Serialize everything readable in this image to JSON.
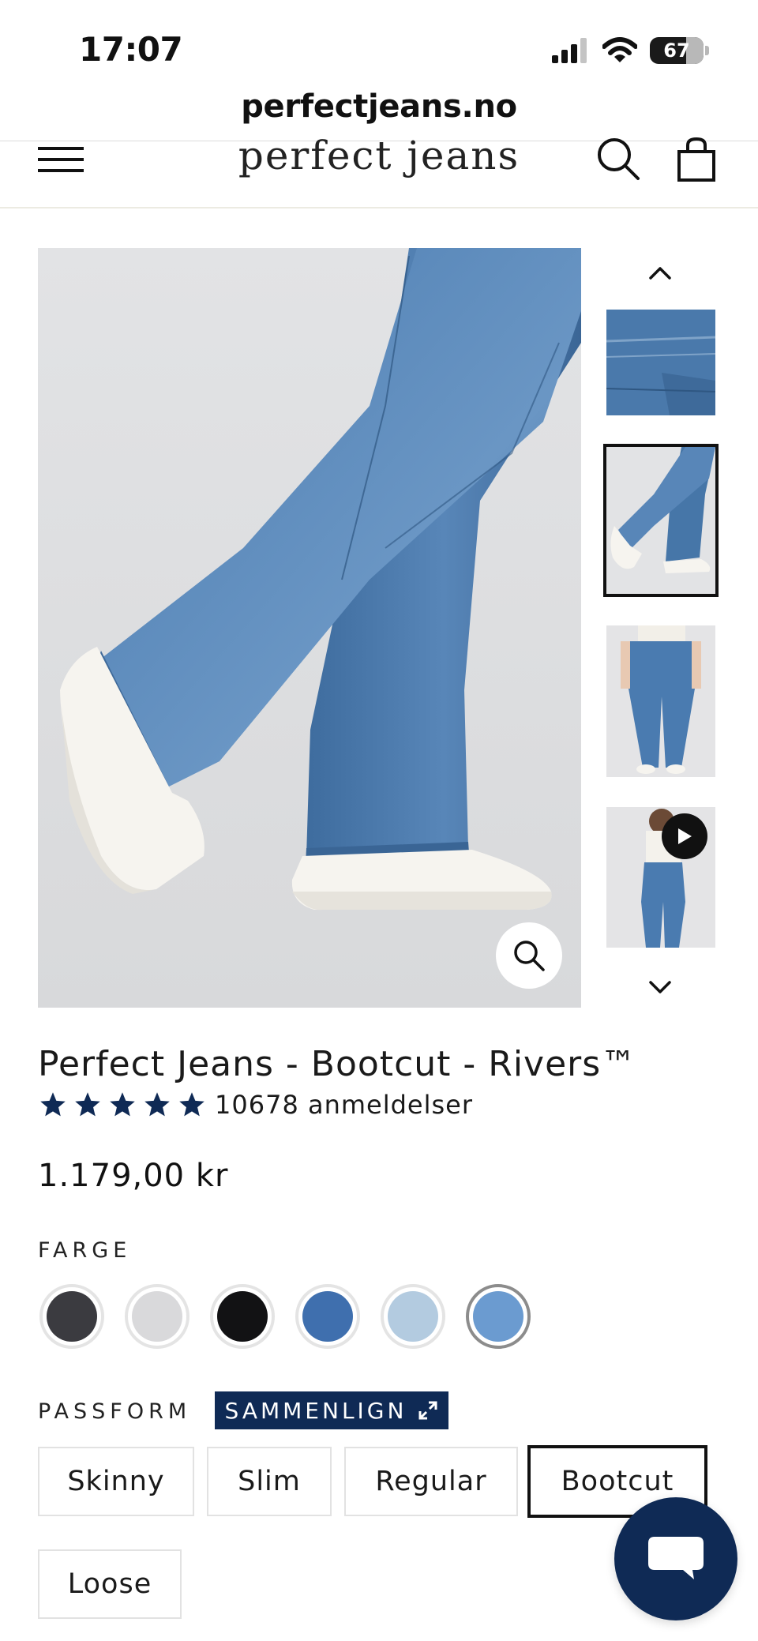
{
  "status_bar": {
    "time": "17:07",
    "battery": "67",
    "battery_level": 0.67
  },
  "browser": {
    "url": "perfectjeans.no"
  },
  "header": {
    "logo": "perfect jeans"
  },
  "product": {
    "title": "Perfect Jeans - Bootcut - Rivers™",
    "rating_stars": 5,
    "review_count": "10678 anmeldelser",
    "price": "1.179,00 kr"
  },
  "color_section": {
    "label": "FARGE",
    "swatches": [
      {
        "name": "dark-grey",
        "color": "#3b3b40"
      },
      {
        "name": "light-grey",
        "color": "#d9d9db"
      },
      {
        "name": "black",
        "color": "#121214"
      },
      {
        "name": "mid-blue",
        "color": "#3f6fae"
      },
      {
        "name": "light-blue",
        "color": "#b3cbe0"
      },
      {
        "name": "rivers-blue",
        "color": "#6b9bd0"
      }
    ],
    "selected_index": 5
  },
  "fit_section": {
    "label": "PASSFORM",
    "compare_label": "SAMMENLIGN",
    "options": [
      "Skinny",
      "Slim",
      "Regular",
      "Bootcut",
      "Loose"
    ],
    "selected": "Bootcut"
  },
  "colors": {
    "brand_navy": "#0f2a55",
    "denim": "#4676a8"
  },
  "icons": [
    "menu-icon",
    "search-icon",
    "cart-icon",
    "zoom-icon",
    "chevron-up-icon",
    "chevron-down-icon",
    "play-icon",
    "star-icon",
    "expand-icon",
    "chat-icon"
  ]
}
